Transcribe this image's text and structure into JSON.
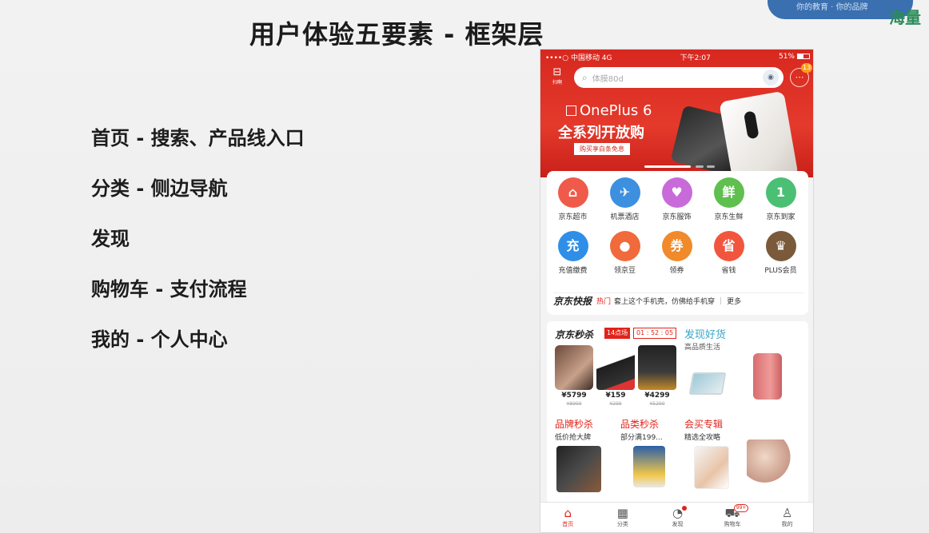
{
  "slide": {
    "title": "用户体验五要素 - 框架层",
    "bullets": [
      "首页 - 搜索、产品线入口",
      "分类 - 侧边导航",
      "发现",
      "购物车 - 支付流程",
      "我的 - 个人中心"
    ],
    "corner_brand": "海量",
    "corner_text": "你的教育 · 你的品牌"
  },
  "phone": {
    "status": {
      "carrier": "••••○ 中国移动 4G",
      "time": "下午2:07",
      "battery": "51%"
    },
    "scan_label": "扫啊",
    "search_placeholder": "体膜80d",
    "message_label": "消息",
    "message_badge": "13",
    "banner": {
      "brand": "OnePlus 6",
      "headline": "全系列开放购",
      "tag": "购买享白条免息"
    },
    "categories": [
      {
        "label": "京东超市",
        "icon": "cart-icon",
        "glyph": "⌂",
        "color": "#f05a4a"
      },
      {
        "label": "机票酒店",
        "icon": "plane-icon",
        "glyph": "✈",
        "color": "#3d8fe0"
      },
      {
        "label": "京东服饰",
        "icon": "shirt-icon",
        "glyph": "♥",
        "color": "#c86ad9"
      },
      {
        "label": "京东生鲜",
        "icon": "fresh-icon",
        "glyph": "鲜",
        "color": "#5fbf4f"
      },
      {
        "label": "京东到家",
        "icon": "delivery-icon",
        "glyph": "1",
        "color": "#4bbf73"
      },
      {
        "label": "充值缴费",
        "icon": "recharge-icon",
        "glyph": "充",
        "color": "#2f8fe8"
      },
      {
        "label": "领京豆",
        "icon": "bean-icon",
        "glyph": "●",
        "color": "#f06a3c"
      },
      {
        "label": "领券",
        "icon": "coupon-icon",
        "glyph": "券",
        "color": "#f08a2a"
      },
      {
        "label": "省钱",
        "icon": "save-money-icon",
        "glyph": "省",
        "color": "#f2553e"
      },
      {
        "label": "PLUS会员",
        "icon": "plus-crown-icon",
        "glyph": "♛",
        "color": "#7a5a3a"
      }
    ],
    "news": {
      "logo": "京东快报",
      "hot": "热门",
      "text": "套上这个手机壳，仿佛给手机穿",
      "more": "更多"
    },
    "seckill": {
      "title": "京东秒杀",
      "session": "14点场",
      "timer": "01 : 52 : 05",
      "items": [
        {
          "price": "¥5799",
          "old": "¥8999"
        },
        {
          "price": "¥159",
          "old": "¥299"
        },
        {
          "price": "¥4299",
          "old": "¥5299"
        }
      ]
    },
    "discover": {
      "title": "发现好货",
      "subtitle": "高品质生活"
    },
    "promos": [
      {
        "title": "品牌秒杀",
        "desc": "低价抢大牌"
      },
      {
        "title": "品类秒杀",
        "desc": "部分满199..."
      },
      {
        "title": "会买专辑",
        "desc": "精选全攻略"
      }
    ],
    "tabs": [
      {
        "label": "首页",
        "icon": "home-icon",
        "glyph": "⌂"
      },
      {
        "label": "分类",
        "icon": "category-icon",
        "glyph": "▦"
      },
      {
        "label": "发现",
        "icon": "discover-icon",
        "glyph": "◔"
      },
      {
        "label": "购物车",
        "icon": "cart-tab-icon",
        "glyph": "⛟",
        "badge": "99+"
      },
      {
        "label": "我的",
        "icon": "profile-icon",
        "glyph": "♙"
      }
    ]
  }
}
